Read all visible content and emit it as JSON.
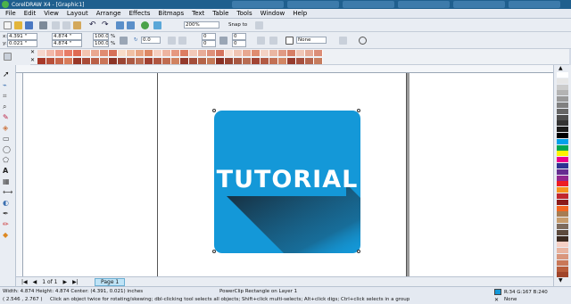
{
  "window": {
    "title": "CorelDRAW X4 - [Graphic1]"
  },
  "menu": [
    "File",
    "Edit",
    "View",
    "Layout",
    "Arrange",
    "Effects",
    "Bitmaps",
    "Text",
    "Table",
    "Tools",
    "Window",
    "Help"
  ],
  "property_bar": {
    "x": "4.391 \"",
    "y": "0.021 \"",
    "width": "4.874 \"",
    "height": "4.874 \"",
    "scale_x": "100.0",
    "scale_y": "100.0",
    "scale_unit": "%",
    "rotation": "0.0",
    "zoom": "200%",
    "snap_to": "Snap to",
    "corner_a": "0",
    "corner_b": "0",
    "corner_c": "0",
    "corner_d": "0",
    "outline": "None"
  },
  "artwork": {
    "text": "TUTORIAL",
    "fill_color": "#1498d8"
  },
  "page_nav": {
    "counter": "1 of 1",
    "page_tab": "Page 1"
  },
  "status": {
    "dimensions": "Width: 4.874  Height: 4.874  Center: (4.391, 0.021)  inches",
    "object_info": "PowerClip Rectangle on Layer 1",
    "cursor_pos": "( 2.546 , 2.767 )",
    "hint": "Click an object twice for rotating/skewing; dbl-clicking tool selects all objects; Shift+click multi-selects; Alt+click digs; Ctrl+click selects in a group",
    "fill_info": "R:34 G:167 B:240",
    "outline_info": "None"
  },
  "colors": {
    "accent": "#1498d8",
    "titlebar": "#1f5f8e"
  },
  "icons": [
    "pick-tool-icon",
    "shape-tool-icon",
    "crop-tool-icon",
    "zoom-tool-icon",
    "freehand-tool-icon",
    "smart-fill-tool-icon",
    "rectangle-tool-icon",
    "ellipse-tool-icon",
    "polygon-tool-icon",
    "text-tool-icon",
    "table-tool-icon",
    "dimension-tool-icon",
    "interactive-tool-icon",
    "eyedropper-tool-icon",
    "outline-tool-icon",
    "fill-tool-icon"
  ]
}
